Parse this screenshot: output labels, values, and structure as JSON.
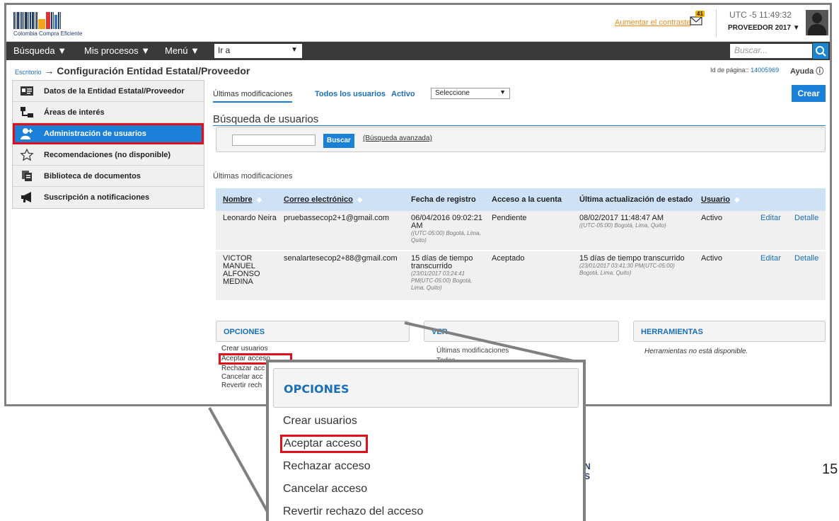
{
  "header": {
    "logo_text": "Colombia Compra Eficiente",
    "contrast_link": "Aumentar el contraste",
    "mail_count": "41",
    "clock": "UTC -5 11:49:32",
    "user_profile": "PROVEEDOR 2017"
  },
  "nav": {
    "items": [
      "Búsqueda",
      "Mis procesos",
      "Menú"
    ],
    "goto_value": "Ir a",
    "search_placeholder": "Buscar..."
  },
  "breadcrumb": {
    "home": "Escritorio",
    "arrow": "→",
    "title": "Configuración Entidad Estatal/Proveedor"
  },
  "page_id": {
    "label": "Id de página::",
    "value": "14005969"
  },
  "help_label": "Ayuda",
  "sidebar": {
    "items": [
      {
        "label": "Datos de la Entidad Estatal/Proveedor",
        "icon": "id-card-icon"
      },
      {
        "label": "Áreas de interés",
        "icon": "hierarchy-icon"
      },
      {
        "label": "Administración de usuarios",
        "icon": "add-user-icon",
        "active": true
      },
      {
        "label": "Recomendaciones (no disponible)",
        "icon": "star-icon"
      },
      {
        "label": "Biblioteca de documentos",
        "icon": "documents-icon"
      },
      {
        "label": "Suscripción a notificaciones",
        "icon": "megaphone-icon"
      }
    ]
  },
  "tabs": {
    "recent": "Últimas modificaciones",
    "all_users": "Todos los usuarios",
    "active": "Activo",
    "status_value": "Seleccione",
    "create_label": "Crear"
  },
  "search": {
    "title": "Búsqueda de usuarios",
    "button": "Buscar",
    "advanced": "(Búsqueda avanzada)"
  },
  "table": {
    "caption": "Últimas modificaciones",
    "headers": [
      "Nombre",
      "Correo electrónico",
      "Fecha de registro",
      "Acceso a la cuenta",
      "Última actualización de estado",
      "Usuario",
      "",
      ""
    ],
    "rows": [
      {
        "name": "Leonardo Neira",
        "email": "pruebassecop2+1@gmail.com",
        "date_main": "06/04/2016 09:02:21 AM",
        "date_small": "((UTC-05:00) Bogotá, Lima, Quito)",
        "access": "Pendiente",
        "update_main": "08/02/2017 11:48:47 AM",
        "update_small": "((UTC-05:00) Bogotá, Lima, Quito)",
        "user": "Activo",
        "edit": "Editar",
        "detail": "Detalle"
      },
      {
        "name": "VICTOR MANUEL ALFONSO MEDINA",
        "email": "senalartesecop2+88@gmail.com",
        "date_main": "15 días de tiempo transcurrido",
        "date_small": "(23/01/2017 03:24:41 PM(UTC-05:00) Bogotá, Lima, Quito)",
        "access": "Aceptado",
        "update_main": "15 días de tiempo transcurrido",
        "update_small": "(23/01/2017 03:41:30 PM(UTC-05:00) Bogotá, Lima, Quito)",
        "user": "Activo",
        "edit": "Editar",
        "detail": "Detalle"
      }
    ]
  },
  "panels": {
    "options_title": "OPCIONES",
    "options": [
      "Crear usuarios",
      "Aceptar acceso",
      "Rechazar acceso",
      "Cancelar acceso",
      "Revertir rechazo del acceso"
    ],
    "options_visible": [
      "Crear usuarios",
      "Aceptar acceso",
      "Rechazar acc",
      "Cancelar acc",
      "Revertir rech"
    ],
    "ver_title": "VER",
    "ver_items": [
      "Últimas modificaciones",
      "Todos"
    ],
    "tools_title": "HERRAMIENTAS",
    "tools_text": "Herramientas no está disponible."
  },
  "slide": {
    "page_number": "15",
    "bg_logo": [
      "N",
      "S"
    ]
  },
  "colors": {
    "accent": "#1a80d8",
    "highlight": "#e0101a",
    "nav_bg": "#3a3a3a",
    "link": "#1a6fb8"
  }
}
